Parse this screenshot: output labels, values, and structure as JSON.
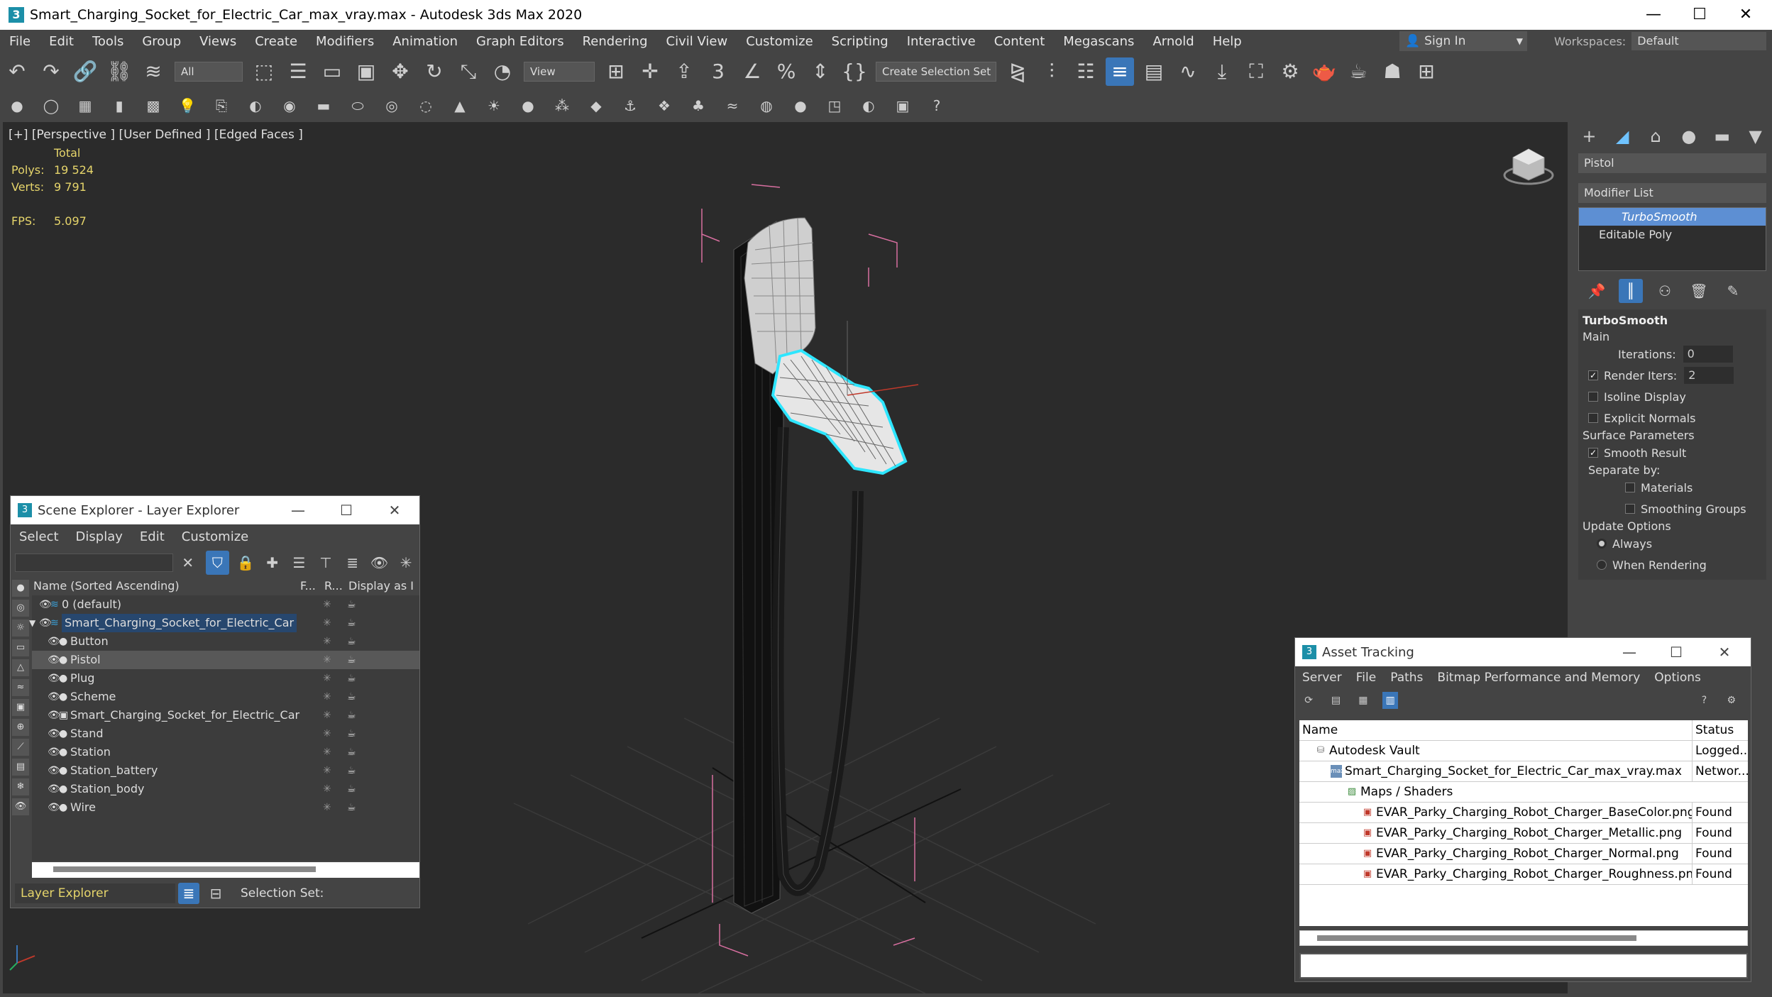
{
  "title_bar": {
    "title": "Smart_Charging_Socket_for_Electric_Car_max_vray.max - Autodesk 3ds Max 2020",
    "app_icon": "3",
    "minimize": "—",
    "maximize": "☐",
    "close": "✕"
  },
  "menu": [
    "File",
    "Edit",
    "Tools",
    "Group",
    "Views",
    "Create",
    "Modifiers",
    "Animation",
    "Graph Editors",
    "Rendering",
    "Civil View",
    "Customize",
    "Scripting",
    "Interactive",
    "Content",
    "Megascans",
    "Arnold",
    "Help"
  ],
  "signin": "Sign In",
  "workspaces": {
    "label": "Workspaces:",
    "value": "Default"
  },
  "toolbar": {
    "filter_value": "All",
    "refcoord_value": "View",
    "selection_set_placeholder": "Create Selection Set"
  },
  "viewport": {
    "label": "[+] [Perspective ] [User Defined ] [Edged Faces ]",
    "stats_header": "Total",
    "polys_label": "Polys:",
    "polys_value": "19 524",
    "verts_label": "Verts:",
    "verts_value": "9 791",
    "fps_label": "FPS:",
    "fps_value": "5.097"
  },
  "command_panel": {
    "object_name": "Pistol",
    "modifier_list": "Modifier List",
    "stack": [
      "TurboSmooth",
      "Editable Poly"
    ],
    "turbosmooth": {
      "title": "TurboSmooth",
      "main": "Main",
      "iterations_label": "Iterations:",
      "iterations_value": "0",
      "render_iters_label": "Render Iters:",
      "render_iters_value": "2",
      "isoline": "Isoline Display",
      "explicit": "Explicit Normals",
      "surface_params": "Surface Parameters",
      "smooth_result": "Smooth Result",
      "separate_by": "Separate by:",
      "materials": "Materials",
      "smoothing_groups": "Smoothing Groups",
      "update_options": "Update Options",
      "always": "Always",
      "when_rendering": "When Rendering"
    }
  },
  "scene_explorer": {
    "title": "Scene Explorer - Layer Explorer",
    "menu": [
      "Select",
      "Display",
      "Edit",
      "Customize"
    ],
    "col_name": "Name (Sorted Ascending)",
    "col_f": "F...",
    "col_r": "R...",
    "col_display": "Display as I",
    "layer_default": "0 (default)",
    "layer_main": "Smart_Charging_Socket_for_Electric_Car",
    "objects": [
      "Button",
      "Pistol",
      "Plug",
      "Scheme",
      "Smart_Charging_Socket_for_Electric_Car",
      "Stand",
      "Station",
      "Station_battery",
      "Station_body",
      "Wire"
    ],
    "bottom_mode": "Layer Explorer",
    "selection_set": "Selection Set:"
  },
  "asset_tracking": {
    "title": "Asset Tracking",
    "menu": [
      "Server",
      "File",
      "Paths",
      "Bitmap Performance and Memory",
      "Options"
    ],
    "col_name": "Name",
    "col_status": "Status",
    "rows": [
      {
        "name": "Autodesk Vault",
        "status": "Logged..."
      },
      {
        "name": "Smart_Charging_Socket_for_Electric_Car_max_vray.max",
        "status": "Networ..."
      },
      {
        "name": "Maps / Shaders",
        "status": ""
      },
      {
        "name": "EVAR_Parky_Charging_Robot_Charger_BaseColor.png",
        "status": "Found"
      },
      {
        "name": "EVAR_Parky_Charging_Robot_Charger_Metallic.png",
        "status": "Found"
      },
      {
        "name": "EVAR_Parky_Charging_Robot_Charger_Normal.png",
        "status": "Found"
      },
      {
        "name": "EVAR_Parky_Charging_Robot_Charger_Roughness.png",
        "status": "Found"
      }
    ]
  },
  "colors": {
    "selection_cyan": "#2ee6ff",
    "stats_yellow": "#e6d56b",
    "accent_blue": "#3a76b8"
  }
}
